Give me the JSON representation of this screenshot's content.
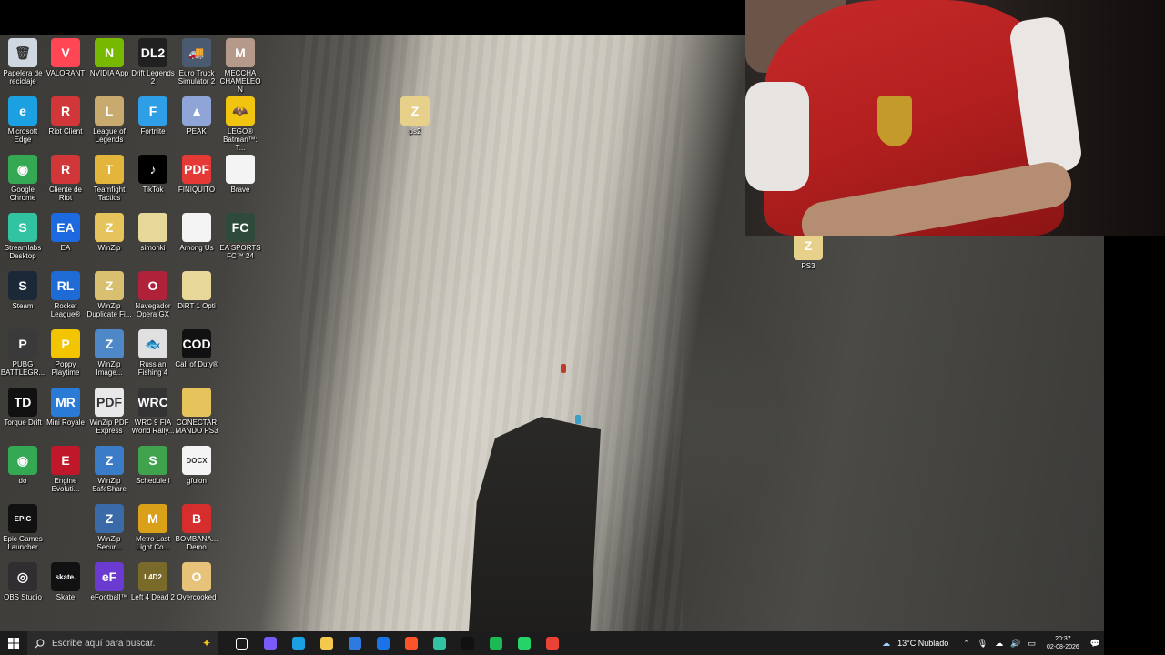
{
  "desktop_icons": [
    {
      "label": "Papelera de reciclaje",
      "icon": "recycle-bin-icon",
      "color": "#cfd8e0",
      "text": "🗑"
    },
    {
      "label": "VALORANT",
      "icon": "valorant-icon",
      "color": "#ff4655",
      "text": "V"
    },
    {
      "label": "NVIDIA App",
      "icon": "nvidia-icon",
      "color": "#76b900",
      "text": "N"
    },
    {
      "label": "Drift Legends 2",
      "icon": "drift-legends-icon",
      "color": "#202020",
      "text": "DL2"
    },
    {
      "label": "Euro Truck Simulator 2",
      "icon": "euro-truck-icon",
      "color": "#4a5a70",
      "text": "🚚"
    },
    {
      "label": "MECCHA CHAMELEON",
      "icon": "meccha-chameleon-icon",
      "color": "#b59a8a",
      "text": "M"
    },
    {
      "label": "Microsoft Edge",
      "icon": "edge-icon",
      "color": "#1ba1e2",
      "text": "e"
    },
    {
      "label": "Riot Client",
      "icon": "riot-client-icon",
      "color": "#d13639",
      "text": "R"
    },
    {
      "label": "League of Legends",
      "icon": "league-of-legends-icon",
      "color": "#c8aa6e",
      "text": "L"
    },
    {
      "label": "Fortnite",
      "icon": "fortnite-icon",
      "color": "#2e9fe6",
      "text": "F"
    },
    {
      "label": "PEAK",
      "icon": "peak-icon",
      "color": "#8fa5d8",
      "text": "▲"
    },
    {
      "label": "LEGO® Batman™: T...",
      "icon": "lego-batman-icon",
      "color": "#f1c40f",
      "text": "🦇"
    },
    {
      "label": "Google Chrome",
      "icon": "chrome-icon",
      "color": "#34a853",
      "text": "◉"
    },
    {
      "label": "Cliente de Riot",
      "icon": "riot-client-2-icon",
      "color": "#d13639",
      "text": "R"
    },
    {
      "label": "Teamfight Tactics",
      "icon": "teamfight-tactics-icon",
      "color": "#e3b53a",
      "text": "T"
    },
    {
      "label": "TikTok",
      "icon": "tiktok-icon",
      "color": "#000000",
      "text": "♪"
    },
    {
      "label": "FINIQUITO",
      "icon": "pdf-file-icon",
      "color": "#e53935",
      "text": "PDF"
    },
    {
      "label": "Brave",
      "icon": "file-icon",
      "color": "#f4f4f4",
      "text": ""
    },
    {
      "label": "Streamlabs Desktop",
      "icon": "streamlabs-icon",
      "color": "#31c3a2",
      "text": "S"
    },
    {
      "label": "EA",
      "icon": "ea-icon",
      "color": "#1d6ae0",
      "text": "EA"
    },
    {
      "label": "WinZip",
      "icon": "winzip-icon",
      "color": "#e7c45b",
      "text": "Z"
    },
    {
      "label": "simonki",
      "icon": "folder-icon",
      "color": "#e7d89a",
      "text": ""
    },
    {
      "label": "Among Us",
      "icon": "file-icon",
      "color": "#f4f4f4",
      "text": ""
    },
    {
      "label": "EA SPORTS FC™ 24",
      "icon": "ea-fc24-icon",
      "color": "#2d4a3a",
      "text": "FC"
    },
    {
      "label": "Steam",
      "icon": "steam-icon",
      "color": "#1b2838",
      "text": "S"
    },
    {
      "label": "Rocket League®",
      "icon": "rocket-league-icon",
      "color": "#1f6bd6",
      "text": "RL"
    },
    {
      "label": "WinZip Duplicate Fi...",
      "icon": "winzip-duplicate-icon",
      "color": "#d9c070",
      "text": "Z"
    },
    {
      "label": "Navegador Opera GX",
      "icon": "opera-gx-icon",
      "color": "#b0213a",
      "text": "O"
    },
    {
      "label": "DiRT 1 Opti",
      "icon": "folder-icon",
      "color": "#e7d89a",
      "text": ""
    },
    {
      "label": "PUBG BATTLEGR...",
      "icon": "pubg-icon",
      "color": "#3a3a3a",
      "text": "P"
    },
    {
      "label": "Poppy Playtime",
      "icon": "poppy-playtime-icon",
      "color": "#f2c500",
      "text": "P"
    },
    {
      "label": "WinZip Image...",
      "icon": "winzip-image-icon",
      "color": "#4f88c8",
      "text": "Z"
    },
    {
      "label": "Russian Fishing 4",
      "icon": "russian-fishing-icon",
      "color": "#e0e0e0",
      "text": "🐟"
    },
    {
      "label": "Call of Duty®",
      "icon": "call-of-duty-icon",
      "color": "#111111",
      "text": "COD"
    },
    {
      "label": "Torque Drift",
      "icon": "torque-drift-icon",
      "color": "#111111",
      "text": "TD"
    },
    {
      "label": "Mini Royale",
      "icon": "mini-royale-icon",
      "color": "#2a7bd6",
      "text": "MR"
    },
    {
      "label": "WinZip PDF Express",
      "icon": "winzip-pdf-icon",
      "color": "#e8e8e8",
      "text": "PDF"
    },
    {
      "label": "WRC 9 FIA World Rally...",
      "icon": "wrc9-icon",
      "color": "#333333",
      "text": "WRC"
    },
    {
      "label": "CONECTAR MANDO PS3",
      "icon": "folder-icon",
      "color": "#e7c45b",
      "text": ""
    },
    {
      "label": "do",
      "icon": "chrome-icon",
      "color": "#34a853",
      "text": "◉"
    },
    {
      "label": "Engine Evoluti...",
      "icon": "engine-evolution-icon",
      "color": "#c0182a",
      "text": "E"
    },
    {
      "label": "WinZip SafeShare",
      "icon": "winzip-safeshare-icon",
      "color": "#3a7cc8",
      "text": "Z"
    },
    {
      "label": "Schedule I",
      "icon": "schedule-icon",
      "color": "#3fa34d",
      "text": "S"
    },
    {
      "label": "gfuion",
      "icon": "docx-file-icon",
      "color": "#f4f4f4",
      "text": "DOCX"
    },
    {
      "label": "Epic Games Launcher",
      "icon": "epic-games-icon",
      "color": "#111111",
      "text": "EPIC"
    },
    {
      "label": "WinZip Secur...",
      "icon": "winzip-secure-icon",
      "color": "#3a6aa8",
      "text": "Z"
    },
    {
      "label": "Metro Last Light Co...",
      "icon": "metro-icon",
      "color": "#d9a018",
      "text": "M"
    },
    {
      "label": "BOMBANA... Demo",
      "icon": "bombana-icon",
      "color": "#d62d2d",
      "text": "B"
    },
    {
      "label": "OBS Studio",
      "icon": "obs-icon",
      "color": "#302e31",
      "text": "◎"
    },
    {
      "label": "Skate",
      "icon": "skate-icon",
      "color": "#111111",
      "text": "skate."
    },
    {
      "label": "eFootball™",
      "icon": "efootball-icon",
      "color": "#6b3ad0",
      "text": "eF"
    },
    {
      "label": "Left 4 Dead 2",
      "icon": "left4dead-icon",
      "color": "#7a6a2a",
      "text": "L4D2"
    },
    {
      "label": "Overcooked",
      "icon": "overcooked-icon",
      "color": "#e7c37a",
      "text": "O"
    },
    {
      "label": "ps2",
      "icon": "zip-folder-icon",
      "color": "#e7d089",
      "text": "Z"
    },
    {
      "label": "PS3",
      "icon": "zip-folder-icon",
      "color": "#e7d089",
      "text": "Z"
    }
  ],
  "taskbar": {
    "search_placeholder": "Escribe aquí para buscar.",
    "apps": [
      {
        "name": "task-view",
        "color": "#ffffff"
      },
      {
        "name": "copilot",
        "color": "#7a5af8"
      },
      {
        "name": "edge",
        "color": "#1ba1e2"
      },
      {
        "name": "file-explorer",
        "color": "#f2c94c"
      },
      {
        "name": "microsoft-store",
        "color": "#2d7be0"
      },
      {
        "name": "outlook",
        "color": "#1a73e8"
      },
      {
        "name": "brave",
        "color": "#fb542b"
      },
      {
        "name": "streamlabs",
        "color": "#31c3a2"
      },
      {
        "name": "tiktok",
        "color": "#111111"
      },
      {
        "name": "spotify",
        "color": "#1db954"
      },
      {
        "name": "whatsapp",
        "color": "#25d366"
      },
      {
        "name": "chrome",
        "color": "#ea4335"
      }
    ],
    "weather": "13°C  Nublado",
    "time": "20:37",
    "date": "02-08-2026"
  }
}
